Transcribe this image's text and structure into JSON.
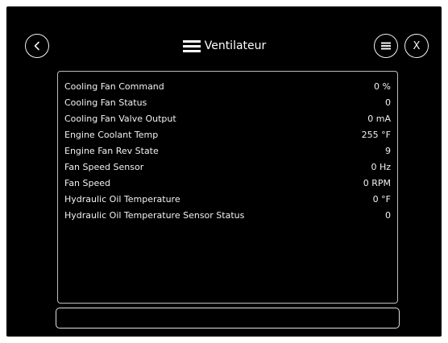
{
  "header": {
    "title": "Ventilateur",
    "close_label": "X"
  },
  "icons": {
    "back": "chevron-left-icon",
    "title": "hamburger-menu-icon",
    "menu": "list-menu-icon"
  },
  "colors": {
    "background": "#000000",
    "text": "#ffffff",
    "border": "#bdbdbd"
  },
  "rows": [
    {
      "label": "Cooling Fan Command",
      "value": "0 %"
    },
    {
      "label": "Cooling Fan Status",
      "value": "0"
    },
    {
      "label": "Cooling Fan Valve Output",
      "value": "0 mA"
    },
    {
      "label": "Engine Coolant Temp",
      "value": "255 °F"
    },
    {
      "label": "Engine Fan Rev State",
      "value": "9"
    },
    {
      "label": "Fan Speed Sensor",
      "value": "0 Hz"
    },
    {
      "label": "Fan Speed",
      "value": "0 RPM"
    },
    {
      "label": "Hydraulic Oil Temperature",
      "value": "0 °F"
    },
    {
      "label": "Hydraulic Oil Temperature Sensor Status",
      "value": "0"
    }
  ],
  "status_bar": {
    "text": ""
  }
}
